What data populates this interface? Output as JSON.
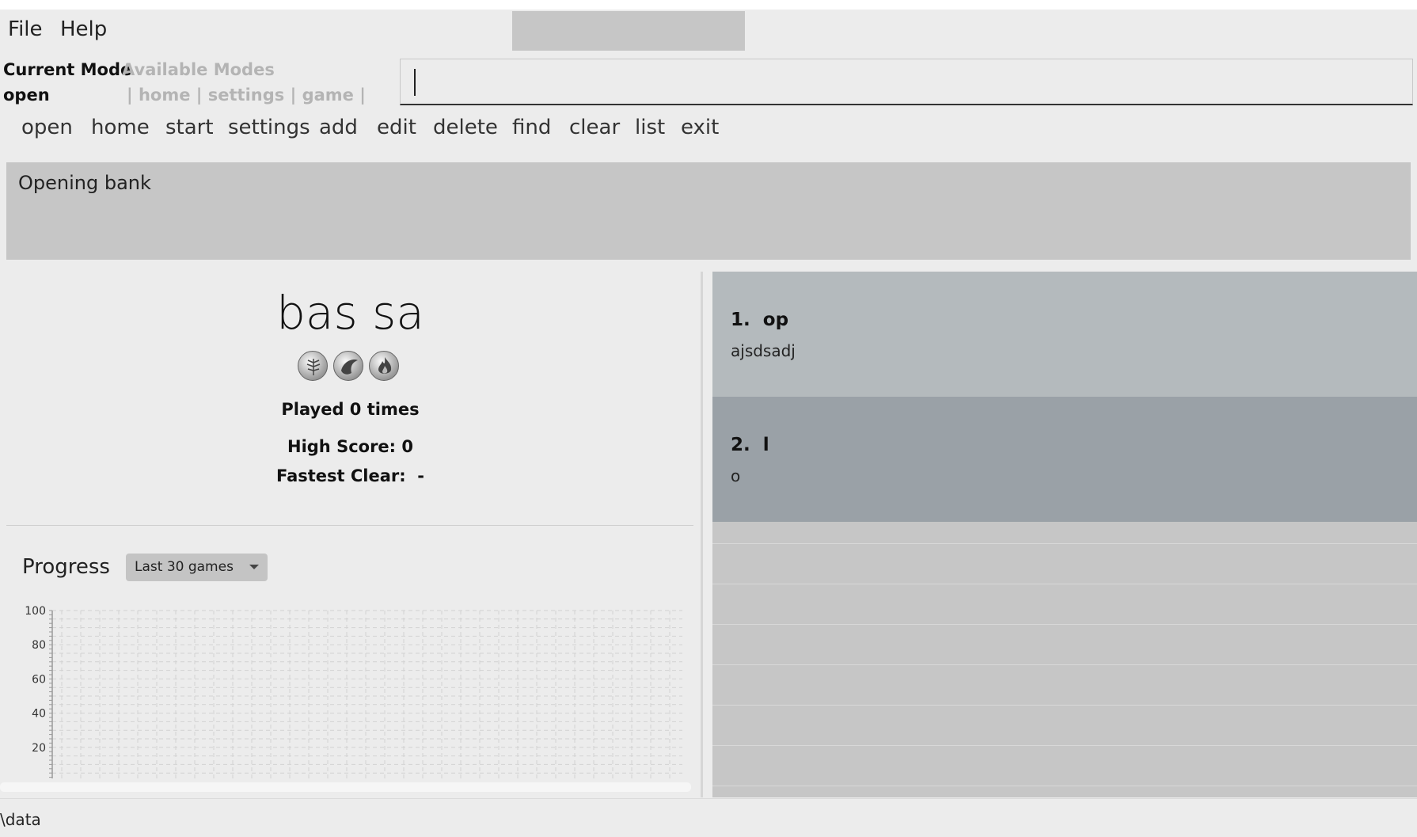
{
  "menu": {
    "file": "File",
    "help": "Help"
  },
  "mode": {
    "current_label": "Current Mode",
    "available_label": "Available Modes",
    "current_value": "open",
    "available_value": "| home | settings | game |"
  },
  "command_input": {
    "value": ""
  },
  "commands": [
    "open",
    "home",
    "start",
    "settings",
    "add",
    "edit",
    "delete",
    "find",
    "clear",
    "list",
    "exit"
  ],
  "result": {
    "text": "Opening bank"
  },
  "bank": {
    "title": "bas sa",
    "icons": [
      "leaf-icon",
      "water-icon",
      "fire-icon"
    ],
    "played": "Played 0 times",
    "high_score": "High Score: 0",
    "fastest_clear": "Fastest Clear:  -"
  },
  "progress": {
    "label": "Progress",
    "dropdown_selected": "Last 30 games"
  },
  "chart_data": {
    "type": "line",
    "title": "",
    "xlabel": "",
    "ylabel": "",
    "ylim": [
      0,
      100
    ],
    "yticks": [
      "100",
      "80",
      "60",
      "40",
      "20"
    ],
    "grid": true,
    "series": []
  },
  "word_list": [
    {
      "index": "1.",
      "word": "op",
      "meaning": "ajsdsadj"
    },
    {
      "index": "2.",
      "word": "l",
      "meaning": "o"
    }
  ],
  "status": {
    "text": "\\data"
  },
  "colors": {
    "selected_row": "#9aa1a7",
    "row": "#b4babd",
    "panel": "#c6c6c6"
  }
}
